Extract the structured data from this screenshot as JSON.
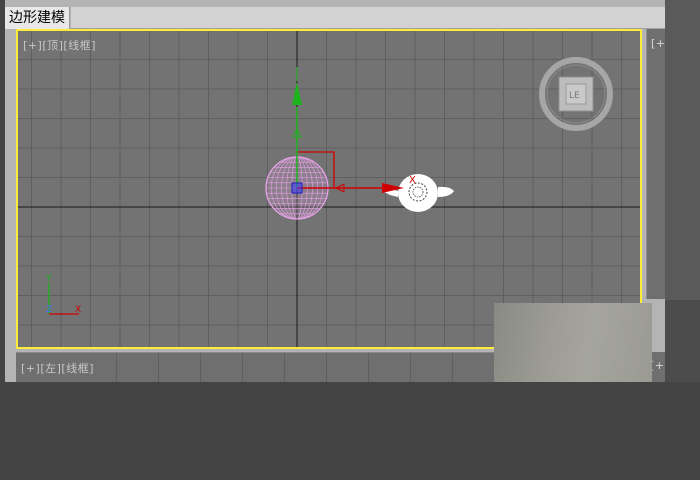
{
  "window": {
    "title_tab": "边形建模"
  },
  "viewports": {
    "top": {
      "label_plus": "[+]",
      "label_view": "[顶]",
      "label_mode": "[线框]"
    },
    "left": {
      "label_plus": "[+]",
      "label_view": "[左]",
      "label_mode": "[线框]"
    },
    "right_partial": {
      "label_top": "[+",
      "label_bottom": "[+"
    }
  },
  "axis_tripod": {
    "y_label": "Y",
    "z_label": "Z",
    "x_label": "X"
  },
  "gizmo": {
    "x_label": "X"
  },
  "viewcube": {
    "face_label": "LE"
  },
  "colors": {
    "active_border": "#ffeb3b",
    "viewport_bg": "#737373",
    "grid_line": "#5f5f5f",
    "axis_x": "#d00000",
    "axis_y": "#1db31d",
    "sphere_wire": "#e6a3e6",
    "teapot": "#ffffff"
  },
  "icons": {
    "move_gizmo": "move-gizmo-icon",
    "view_cube": "viewcube-icon",
    "axis_tripod": "axis-tripod-icon"
  }
}
